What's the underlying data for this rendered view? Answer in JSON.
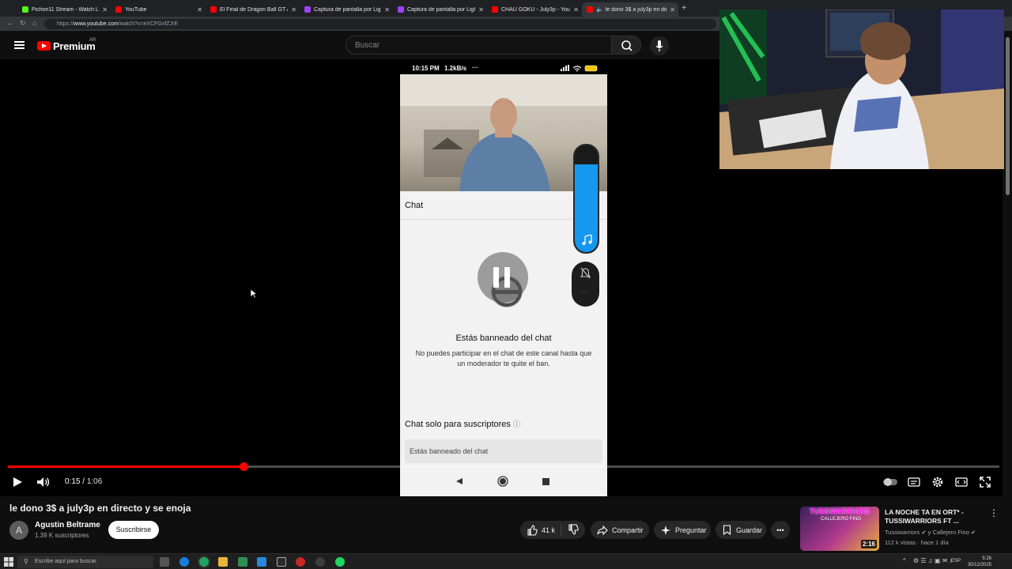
{
  "browser": {
    "tabs": [
      {
        "title": "Pichon11 Stream - Watch Live on ...",
        "color": "#53fc18"
      },
      {
        "title": "YouTube",
        "color": "#ff0000"
      },
      {
        "title": "El Final de Dragon Ball GT Audio L...",
        "color": "#ff0000"
      },
      {
        "title": "Captura de pantalla por Lightshot",
        "color": "#a142f4"
      },
      {
        "title": "Captura de pantalla por Lightshot",
        "color": "#a142f4"
      },
      {
        "title": "CHAU GOKU - July3p - YouTube",
        "color": "#ff0000"
      },
      {
        "title": "le dono 3$ a july3p en directo...",
        "color": "#ff0000"
      }
    ],
    "new_tab": "+",
    "url_prefix": "https://",
    "url_host": "www.youtube.com",
    "url_path": "/watch?v=eXCFGxfZJrE"
  },
  "masthead": {
    "brand": "Premium",
    "region": "AR",
    "search_placeholder": "Buscar"
  },
  "phone": {
    "status_time": "10:15 PM",
    "status_speed": "1.2kB/s",
    "status_more": "···",
    "chat_title": "Chat",
    "ban_title": "Estás banneado del chat",
    "ban_description": "No puedes participar en el chat de este canal hasta que un moderador te quite el ban.",
    "subs_only_label": "Chat solo para suscriptores",
    "chat_input_text": "Estás banneado del chat",
    "volume_level": 0.82
  },
  "player": {
    "time_current": "0:15",
    "time_total": "1:06",
    "progress": 0.238
  },
  "video": {
    "title": "le dono 3$ a july3p en directo y se enoja",
    "channel_initial": "A",
    "channel_name": "Agustin Beltrame",
    "channel_subs": "1.39 K suscriptores",
    "subscribe_label": "Suscribirse",
    "likes": "41 k",
    "share_label": "Compartir",
    "ask_label": "Preguntar",
    "save_label": "Guardar"
  },
  "recommended": {
    "thumb_brand": "TUSSIWARRIORS",
    "thumb_sub": "CALLEJERO FINO",
    "duration": "2:16",
    "title": "LA NOCHE TA EN ORT* - TUSSIWARRIORS FT ...",
    "channel": "Tussiwarriors",
    "channel_joiner": "y Callejero Fino",
    "meta": "112 k vistas · hace 1 día"
  },
  "taskbar": {
    "search_placeholder": "Escribe aquí para buscar.",
    "lang": "ESP",
    "time": "5:26",
    "date": "30/12/2025"
  }
}
